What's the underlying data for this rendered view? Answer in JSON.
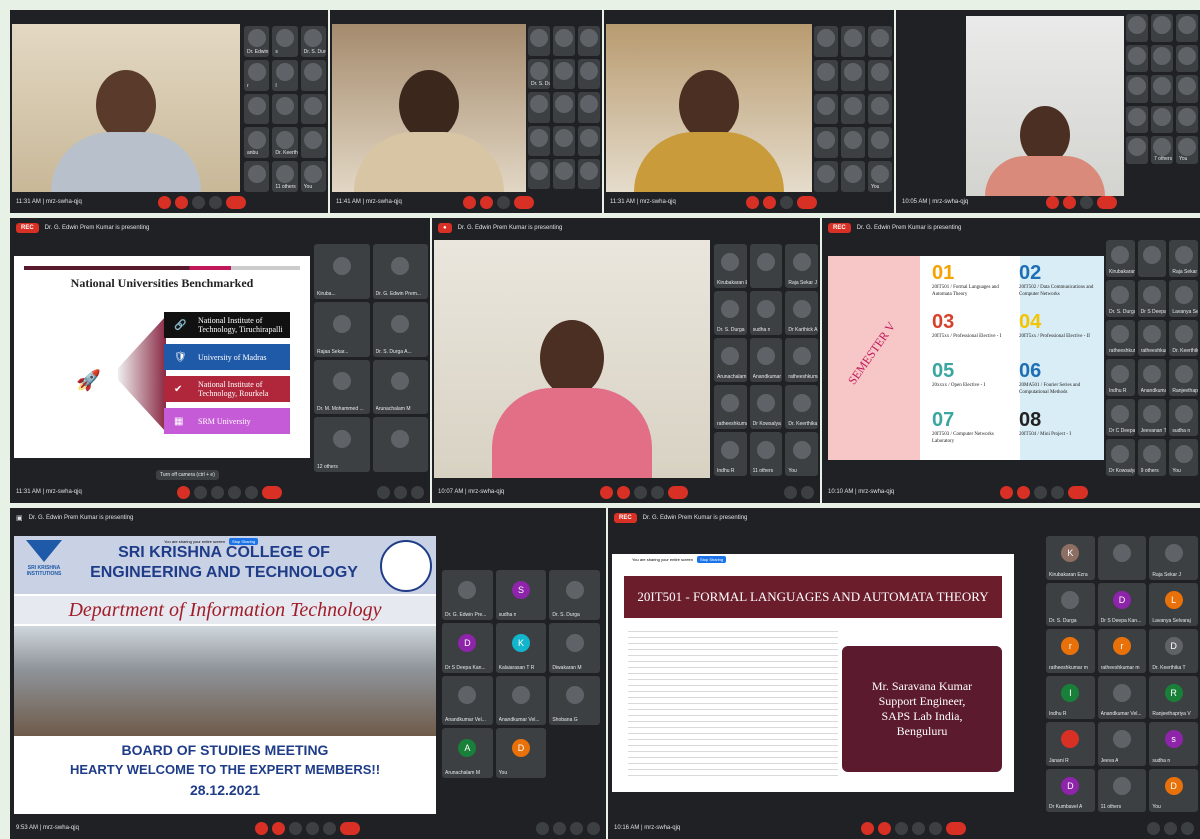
{
  "r1": {
    "w1": {
      "tiles": [
        "Dr. Edwin Prem...",
        "s",
        "Dr. S. Durga",
        "r",
        "I",
        "",
        "",
        "",
        "",
        "anbu",
        "Dr. Keerthika T",
        "",
        "",
        "11 others",
        "You"
      ],
      "footer_time": "11:31 AM",
      "footer_code": "mrz-swha-qjq"
    },
    "w2": {
      "footer_time": "11:41 AM",
      "footer_code": "mrz-swha-qjq",
      "tiles": [
        "",
        "",
        "",
        "Dr. S. Durga",
        "",
        "",
        "",
        "",
        "",
        "",
        "",
        "",
        "",
        "",
        "",
        "You"
      ]
    },
    "w3": {
      "footer_time": "11:31 AM",
      "footer_code": "mrz-swha-qjq",
      "tiles": [
        "",
        "",
        "",
        "",
        "",
        "",
        "",
        "",
        "",
        "",
        "",
        "",
        "",
        "",
        "You"
      ]
    },
    "w4": {
      "footer_time": "10:05 AM",
      "footer_code": "mrz-swha-qjq",
      "tiles": [
        "",
        "",
        "",
        "",
        "",
        "",
        "",
        "",
        "",
        "",
        "",
        "",
        "",
        "7 others",
        "You"
      ]
    }
  },
  "r2": {
    "w1": {
      "rec": "REC",
      "presenting": "Dr. G. Edwin Prem Kumar is presenting",
      "slide_title": "National Universities Benchmarked",
      "items": [
        "National Institute of Technology, Tiruchirapalli",
        "University of Madras",
        "National Institute of Technology, Rourkela",
        "SRM University"
      ],
      "tiles": [
        "Kiruba...",
        "Dr. G. Edwin Prem...",
        "Rajaa Sekar...",
        "Dr. S. Durga A...",
        "Dr. M. Mohammed ...",
        "Arunachalam M",
        "12 others",
        ""
      ],
      "av_d": "D",
      "av_others": "B",
      "tooltip": "Turn off camera (ctrl + e)",
      "footer_time": "11:31 AM",
      "footer_code": "mrz-swha-qjq"
    },
    "w2": {
      "presenting": "Dr. G. Edwin Prem Kumar is presenting",
      "tiles": [
        "Kirubakaran Ezra",
        "",
        "Raja Sekar J",
        "Dr. S. Durga",
        "sudha n",
        "Dr Karthick A",
        "Arunachalam M",
        "Anandkumar Vel...",
        "ratheeshkumar m",
        "ratheeshkumar m",
        "Dr Kowsalya A",
        "Dr. Keerthika T",
        "Indhu R",
        "11 others",
        "You"
      ],
      "footer_time": "10:07 AM",
      "footer_code": "mrz-swha-qjq"
    },
    "w3": {
      "rec": "REC",
      "presenting": "Dr. G. Edwin Prem Kumar is presenting",
      "semester": "SEMESTER V",
      "cells": [
        {
          "num": "01",
          "text": "20IT501 / Formal Languages and Automata Theory",
          "color": "#f4a300"
        },
        {
          "num": "02",
          "text": "20IT502 / Data Communications and Computer Networks",
          "color": "#1e6fb5"
        },
        {
          "num": "03",
          "text": "20IT5xx / Professional Elective - I",
          "color": "#d8402a"
        },
        {
          "num": "04",
          "text": "20IT5xx / Professional Elective - II",
          "color": "#f2c500"
        },
        {
          "num": "05",
          "text": "20xxxx / Open Elective - I",
          "color": "#3aa6a0"
        },
        {
          "num": "06",
          "text": "20MA501 / Fourier Series and Computational Methods",
          "color": "#1e6fb5"
        },
        {
          "num": "07",
          "text": "20IT503 / Computer Networks Laboratory",
          "color": "#3aa6a0"
        },
        {
          "num": "08",
          "text": "20IT504 / Mini Project - I",
          "color": "#222222"
        }
      ],
      "tiles": [
        "Kirubakaran Ezra",
        "",
        "Raja Sekar J",
        "Dr. S. Durga",
        "Dr S Deepa Ran...",
        "Lavanya Selvaraj",
        "ratheeshkumar m",
        "ratheeshkumar m",
        "Dr. Keerthika T",
        "Indhu R",
        "Anandkumar Vel...",
        "Ranjeethapriya",
        "Dr C Deepa Kan...",
        "Jeevanan T R",
        "sudha n",
        "Dr Kowsalya A",
        "9 others",
        "You"
      ],
      "footer_time": "10:10 AM",
      "footer_code": "mrz-swha-qjq"
    }
  },
  "r3": {
    "w1": {
      "presenting": "Dr. G. Edwin Prem Kumar is presenting",
      "college_line1": "SRI KRISHNA COLLEGE OF",
      "college_line2": "ENGINEERING AND TECHNOLOGY",
      "logo_text": "SRI KRISHNA INSTITUTIONS",
      "department": "Department of Information Technology",
      "meeting": "BOARD OF STUDIES MEETING",
      "welcome": "HEARTY WELCOME TO  THE EXPERT MEMBERS!!",
      "date": "28.12.2021",
      "sharing": "You are sharing your entire screen",
      "stop": "Stop Sharing",
      "tiles": [
        {
          "name": "Dr. G. Edwin Pre...",
          "av": "",
          "color": "#5f6368"
        },
        {
          "name": "sudha n",
          "av": "S",
          "color": "#8e24aa"
        },
        {
          "name": "Dr. S. Durga",
          "av": "",
          "color": "#5f6368"
        },
        {
          "name": "Dr S Deepa Kan...",
          "av": "D",
          "color": "#8e24aa"
        },
        {
          "name": "Kalaiarasan T R",
          "av": "K",
          "color": "#12b5cb"
        },
        {
          "name": "Diwakaran M",
          "av": "",
          "color": "#5f6368"
        },
        {
          "name": "Anandkumar Vel...",
          "av": "",
          "color": "#5f6368"
        },
        {
          "name": "Anandkumar Vel...",
          "av": "",
          "color": "#5f6368"
        },
        {
          "name": "Shobana G",
          "av": "",
          "color": "#5f6368"
        },
        {
          "name": "Arunachalam M",
          "av": "A",
          "color": "#188038"
        },
        {
          "name": "You",
          "av": "D",
          "color": "#e8710a"
        }
      ],
      "footer_time": "9:53 AM",
      "footer_code": "mrz-swha-qjq"
    },
    "w2": {
      "rec": "REC",
      "presenting": "Dr. G. Edwin Prem Kumar is presenting",
      "sharing": "You are sharing your entire screen",
      "stop": "Stop Sharing",
      "slide_title": "20IT501 - FORMAL LANGUAGES AND AUTOMATA THEORY",
      "scroll_lines": [
        "Mr. Saravana Kumar",
        "Support Engineer,",
        "SAPS Lab India,",
        "Benguluru"
      ],
      "tiles": [
        {
          "name": "Kirubakaran Ezra",
          "av": "K",
          "color": "#8d6e63"
        },
        {
          "name": "",
          "av": "",
          "color": "#5f6368"
        },
        {
          "name": "Raja Sekar J",
          "av": "",
          "color": "#5f6368"
        },
        {
          "name": "Dr. S. Durga",
          "av": "",
          "color": "#5f6368"
        },
        {
          "name": "Dr S Deepa Kan...",
          "av": "D",
          "color": "#8e24aa"
        },
        {
          "name": "Lavanya Selvaraj",
          "av": "L",
          "color": "#e8710a"
        },
        {
          "name": "ratheeshkumar m",
          "av": "r",
          "color": "#e8710a"
        },
        {
          "name": "ratheeshkumar m",
          "av": "r",
          "color": "#e8710a"
        },
        {
          "name": "Dr. Keerthika T",
          "av": "D",
          "color": "#5f6368"
        },
        {
          "name": "Indhu R",
          "av": "I",
          "color": "#188038"
        },
        {
          "name": "Anandkumar Vel...",
          "av": "",
          "color": "#5f6368"
        },
        {
          "name": "Ranjeethapriya V",
          "av": "R",
          "color": "#188038"
        },
        {
          "name": "Janani R",
          "av": "",
          "color": "#d93025"
        },
        {
          "name": "Jeeva A",
          "av": "",
          "color": "#5f6368"
        },
        {
          "name": "sudha n",
          "av": "s",
          "color": "#8e24aa"
        },
        {
          "name": "Dr Kumbavel A",
          "av": "D",
          "color": "#8e24aa"
        },
        {
          "name": "11 others",
          "av": "",
          "color": "#5f6368"
        },
        {
          "name": "You",
          "av": "D",
          "color": "#e8710a"
        }
      ],
      "footer_time": "10:16 AM",
      "footer_code": "mrz-swha-qjq"
    }
  }
}
